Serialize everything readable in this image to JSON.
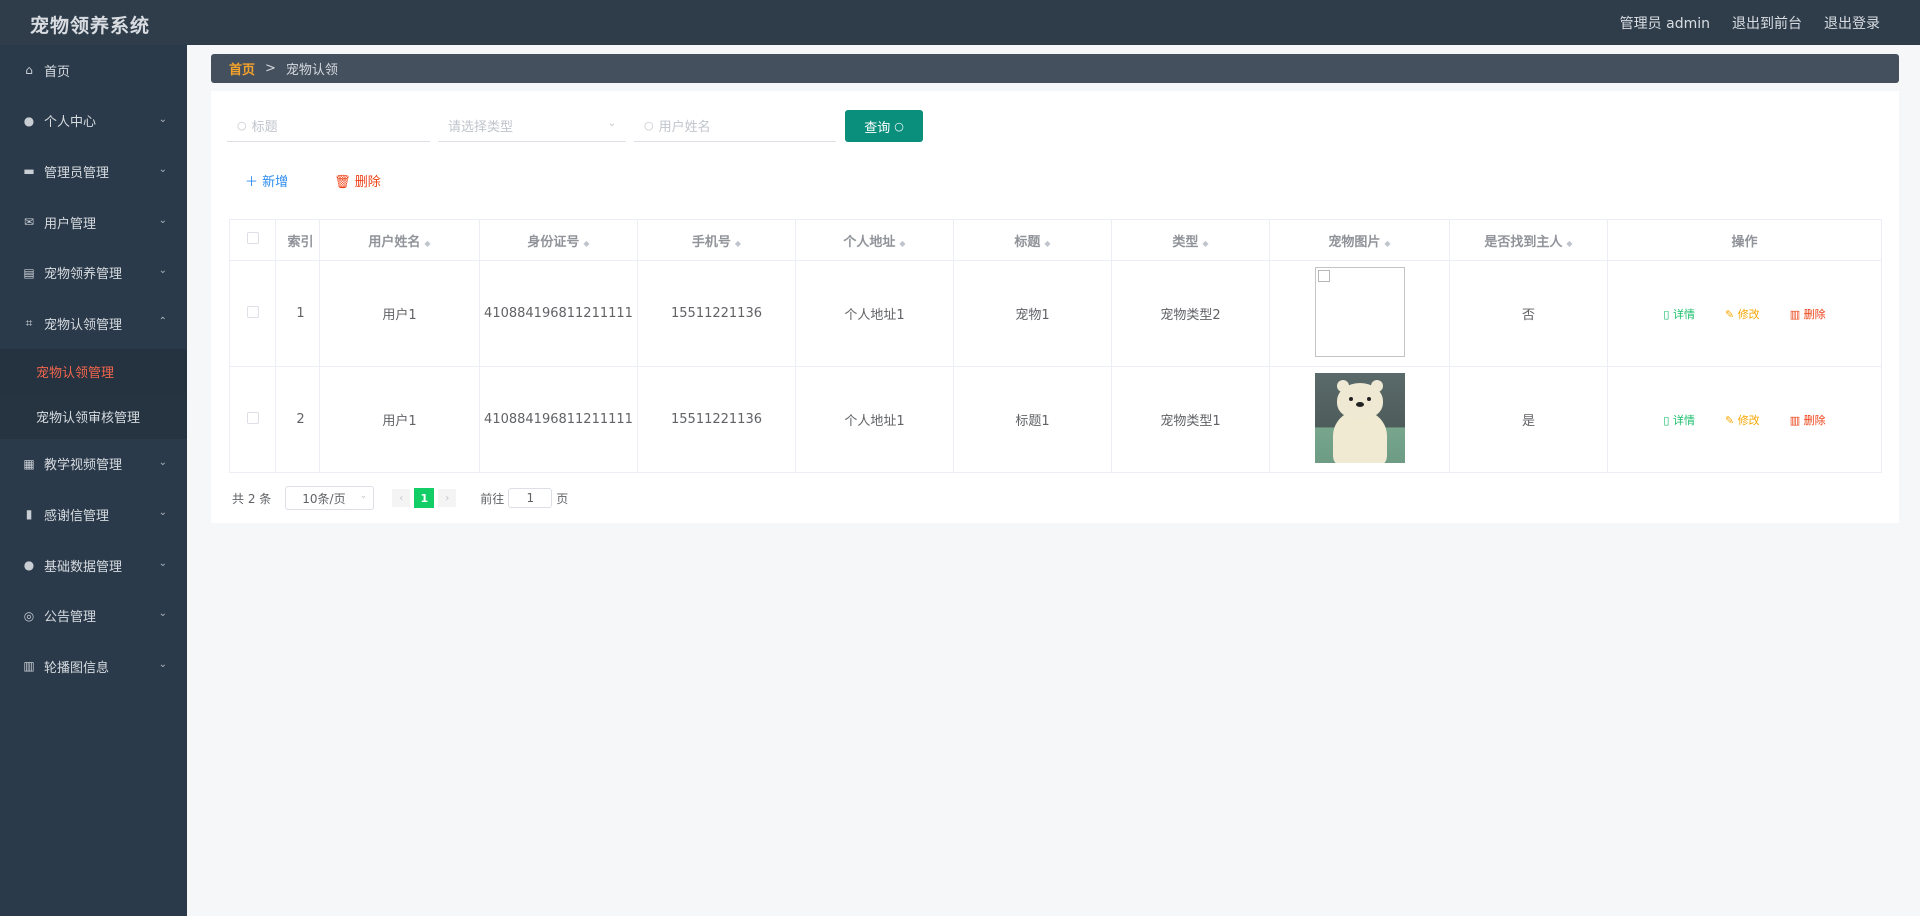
{
  "app": {
    "title": "宠物领养系统"
  },
  "topbar": {
    "user": "管理员 admin",
    "front": "退出到前台",
    "logout": "退出登录"
  },
  "sidebar": {
    "items": [
      {
        "label": "首页",
        "icon": "home-icon",
        "glyph": "⌂"
      },
      {
        "label": "个人中心",
        "icon": "user-icon",
        "glyph": "●"
      },
      {
        "label": "管理员管理",
        "icon": "monitor-icon",
        "glyph": "▬"
      },
      {
        "label": "用户管理",
        "icon": "mail-icon",
        "glyph": "✉"
      },
      {
        "label": "宠物领养管理",
        "icon": "clipboard-icon",
        "glyph": "▤"
      },
      {
        "label": "宠物认领管理",
        "icon": "crop-icon",
        "glyph": "⌗"
      },
      {
        "label": "教学视频管理",
        "icon": "grid-icon",
        "glyph": "▦"
      },
      {
        "label": "感谢信管理",
        "icon": "bar-chart-icon",
        "glyph": "▮"
      },
      {
        "label": "基础数据管理",
        "icon": "user-icon",
        "glyph": "●"
      },
      {
        "label": "公告管理",
        "icon": "compass-icon",
        "glyph": "◎"
      },
      {
        "label": "轮播图信息",
        "icon": "library-icon",
        "glyph": "▥"
      }
    ],
    "sub": [
      {
        "label": "宠物认领管理",
        "active": true
      },
      {
        "label": "宠物认领审核管理",
        "active": false
      }
    ]
  },
  "breadcrumb": {
    "home": "首页",
    "sep": ">",
    "current": "宠物认领"
  },
  "search": {
    "title_placeholder": "标题",
    "type_placeholder": "请选择类型",
    "user_placeholder": "用户姓名",
    "query_label": "查询"
  },
  "actions": {
    "add": "新增",
    "delete": "删除"
  },
  "table": {
    "headers": [
      "索引",
      "用户姓名",
      "身份证号",
      "手机号",
      "个人地址",
      "标题",
      "类型",
      "宠物图片",
      "是否找到主人",
      "操作"
    ],
    "rows": [
      {
        "index": "1",
        "user": "用户1",
        "idcard": "410884196811211111",
        "phone": "15511221136",
        "address": "个人地址1",
        "title": "宠物1",
        "type": "宠物类型2",
        "image": "broken",
        "found": "否"
      },
      {
        "index": "2",
        "user": "用户1",
        "idcard": "410884196811211111",
        "phone": "15511221136",
        "address": "个人地址1",
        "title": "标题1",
        "type": "宠物类型1",
        "image": "bear",
        "found": "是"
      }
    ],
    "ops": {
      "detail": "详情",
      "edit": "修改",
      "remove": "删除"
    }
  },
  "pager": {
    "total": "共 2 条",
    "size": "10条/页",
    "page": "1",
    "goto_prefix": "前往",
    "goto_value": "1",
    "goto_suffix": "页"
  }
}
